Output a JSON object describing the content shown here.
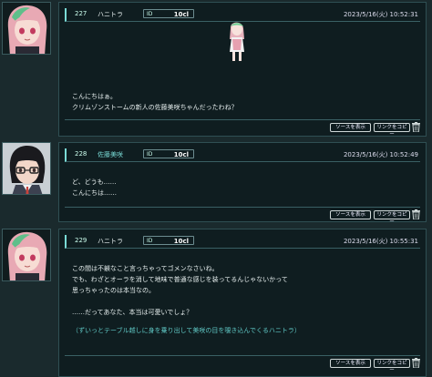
{
  "colors": {
    "background": "#1a2a2d",
    "card": "#0f1d20",
    "accent": "#7adbd6",
    "action_text": "#5fc7c4"
  },
  "common": {
    "id_label": "ID",
    "source_button": "ソースを表示",
    "link_button": "リンクをコピー",
    "trash_icon": "trash-icon"
  },
  "posts": [
    {
      "number": "227",
      "name": "ハニトラ",
      "id": "10cl",
      "date": "2023/5/16(火) 10:52:31",
      "lines": [
        "こんにちはぁ。",
        "クリムゾンストームの新人の佐藤美咲ちゃんだったわね？"
      ]
    },
    {
      "number": "228",
      "name": "佐藤美咲",
      "id": "10cl",
      "date": "2023/5/16(火) 10:52:49",
      "lines": [
        "ど、どうも……",
        "こんにちは……"
      ]
    },
    {
      "number": "229",
      "name": "ハニトラ",
      "id": "10cl",
      "date": "2023/5/16(火) 10:55:31",
      "lines": [
        "この間は不躾なこと言っちゃってゴメンなさいね。",
        "でも、わざとオーラを消して地味で普通な感じを装ってるんじゃないかって",
        "思っちゃったのは本当なの。",
        "",
        "……だってあなた、本当は可愛いでしょ？"
      ],
      "action": "（ずいっとテーブル越しに身を乗り出して美咲の目を覗き込んでくるハニトラ）"
    }
  ]
}
